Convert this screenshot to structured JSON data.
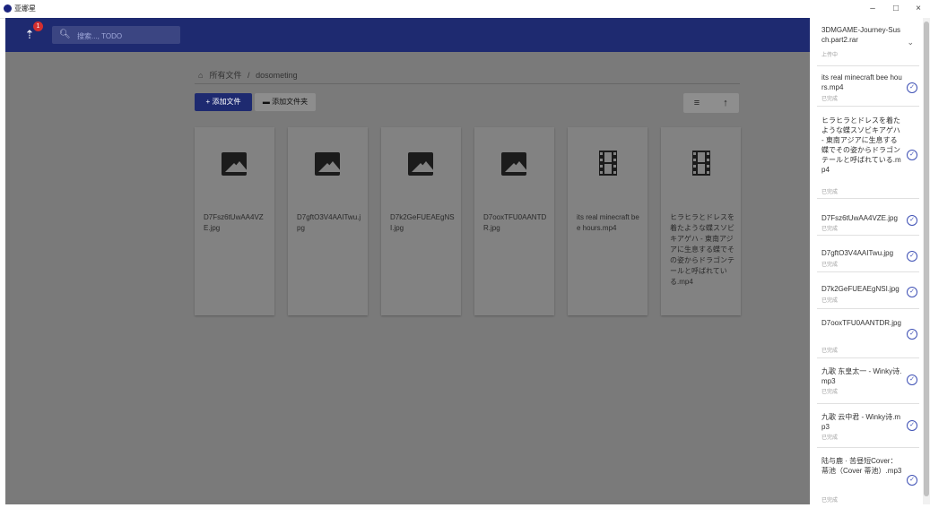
{
  "window": {
    "title": "亚娜星",
    "min_label": "–",
    "max_label": "□",
    "close_label": "×"
  },
  "appbar": {
    "badge_count": "1",
    "search_placeholder": "搜索..., TODO",
    "upload_icon": "upload-icon",
    "search_icon": "search-icon"
  },
  "breadcrumb": {
    "root": "所有文件",
    "separator": "/",
    "current": "dosometing"
  },
  "toolbar": {
    "add_file_label": "+ 添加文件",
    "add_folder_label": "添加文件夹",
    "sort_label": "≡",
    "up_label": "↑"
  },
  "files": [
    {
      "name": "D7Fsz6tUwAA4VZE.jpg",
      "type": "image"
    },
    {
      "name": "D7gftO3V4AAITwu.jpg",
      "type": "image"
    },
    {
      "name": "D7k2GeFUEAEgNSI.jpg",
      "type": "image"
    },
    {
      "name": "D7ooxTFU0AANTDR.jpg",
      "type": "image"
    },
    {
      "name": "its real minecraft bee hours.mp4",
      "type": "video"
    },
    {
      "name": "ヒラヒラとドレスを着たような蝶スソビキアゲハ - 東南アジアに生息する蝶でその姿からドラゴンテールと呼ばれている.mp4",
      "type": "video"
    }
  ],
  "uploads": [
    {
      "name": "3DMGAME-Journey-Susch.part2.rar",
      "status": "上传中",
      "done": false
    },
    {
      "name": "its real minecraft bee hours.mp4",
      "status": "已完成",
      "done": true
    },
    {
      "name": "ヒラヒラとドレスを着たような蝶スソビキアゲハ - 東南アジアに生息する蝶でその姿からドラゴンテールと呼ばれている.mp4",
      "status": "已完成",
      "done": true
    },
    {
      "name": "D7Fsz6tUwAA4VZE.jpg",
      "status": "已完成",
      "done": true
    },
    {
      "name": "D7gftO3V4AAITwu.jpg",
      "status": "已完成",
      "done": true
    },
    {
      "name": "D7k2GeFUEAEgNSI.jpg",
      "status": "已完成",
      "done": true
    },
    {
      "name": "D7ooxTFU0AANTDR.jpg",
      "status": "已完成",
      "done": true
    },
    {
      "name": "九歌 东皇太一 - Winky诗.mp3",
      "status": "已完成",
      "done": true
    },
    {
      "name": "九歌 云中君 - Winky诗.mp3",
      "status": "已完成",
      "done": true
    },
    {
      "name": "陆与鹿 · 苦昼短Cover：蒂池（Cover 蒂池）.mp3",
      "status": "已完成",
      "done": true
    }
  ],
  "colors": {
    "appbar": "#1e2a70",
    "accent": "#3f51b5",
    "badge": "#d32f2f",
    "overlay": "#7a7a7a"
  }
}
